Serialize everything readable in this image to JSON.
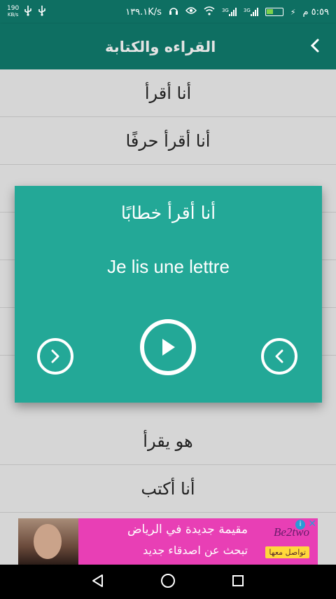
{
  "status_bar": {
    "time": "٥:٥٩ م",
    "network_speed": "١٣٩.١K/s",
    "net_type_1": "3G",
    "net_type_2": "3G",
    "usb_speed": "190",
    "usb_unit": "KB/s"
  },
  "app_bar": {
    "title": "القراءه والكتابة",
    "back_icon": "chevron-left-icon"
  },
  "list": {
    "items": [
      {
        "label": "أنا أقرأ"
      },
      {
        "label": "أنا أقرأ حرفًا"
      },
      {
        "label": ""
      },
      {
        "label": ""
      },
      {
        "label": ""
      },
      {
        "label": ""
      },
      {
        "label": "هو يقرأ"
      },
      {
        "label": "أنا أكتب"
      }
    ]
  },
  "dialog": {
    "arabic_text": "أنا أقرأ خطابًا",
    "french_text": "Je lis une lettre",
    "buttons": {
      "next": "chevron-right-icon",
      "play": "play-icon",
      "previous": "chevron-left-icon"
    }
  },
  "ad": {
    "line1": "مقيمة جديدة في الرياض",
    "line2": "تبحث عن اصدقاء جديد",
    "brand": "Be2two",
    "cta": "تواصل معها",
    "info_icon": "i"
  },
  "colors": {
    "primary_dark": "#0e6f62",
    "dialog_bg": "#23a897",
    "list_bg": "#d6d6d6",
    "ad_bg": "#e83fb5"
  }
}
